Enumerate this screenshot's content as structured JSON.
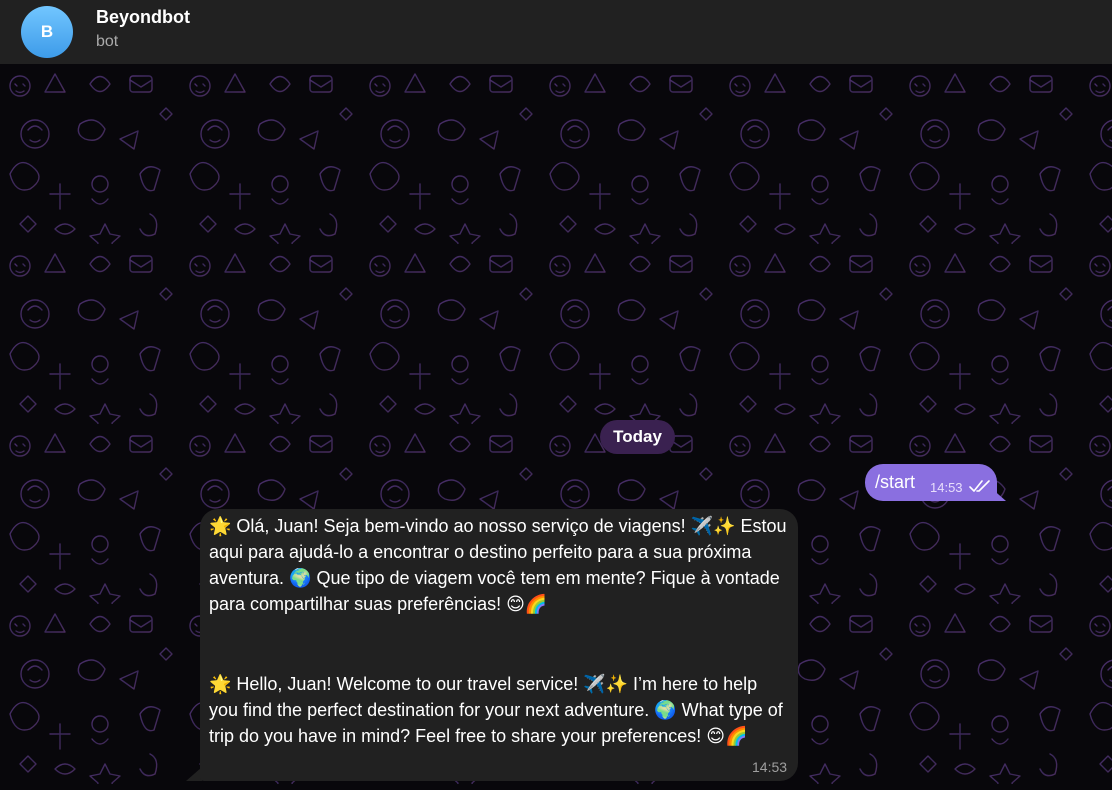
{
  "header": {
    "avatar_initial": "B",
    "title": "Beyondbot",
    "subtitle": "bot",
    "accent": "#3d9be9"
  },
  "chat": {
    "date_separator": "Today",
    "messages": [
      {
        "direction": "outgoing",
        "text": "/start",
        "time": "14:53",
        "status": "read",
        "status_icon": "double-check-icon"
      },
      {
        "direction": "incoming",
        "text_pt": "🌟 Olá, Juan! Seja bem-vindo ao nosso serviço de viagens! ✈️✨ Estou aqui para ajudá-lo a encontrar o destino perfeito para a sua próxima aventura. 🌍 Que tipo de viagem você tem em mente? Fique à vontade para compartilhar suas preferências! 😊🌈",
        "text_en": "🌟 Hello, Juan! Welcome to our travel service! ✈️✨ I’m here to help you find the perfect destination for your next adventure. 🌍 What type of trip do you have in mind? Feel free to share your preferences! 😊🌈",
        "time": "14:53"
      }
    ]
  },
  "colors": {
    "header_bg": "#212121",
    "outgoing_bubble": "#8a6fe0",
    "incoming_bubble": "#212121",
    "date_pill": "#3a2150"
  }
}
